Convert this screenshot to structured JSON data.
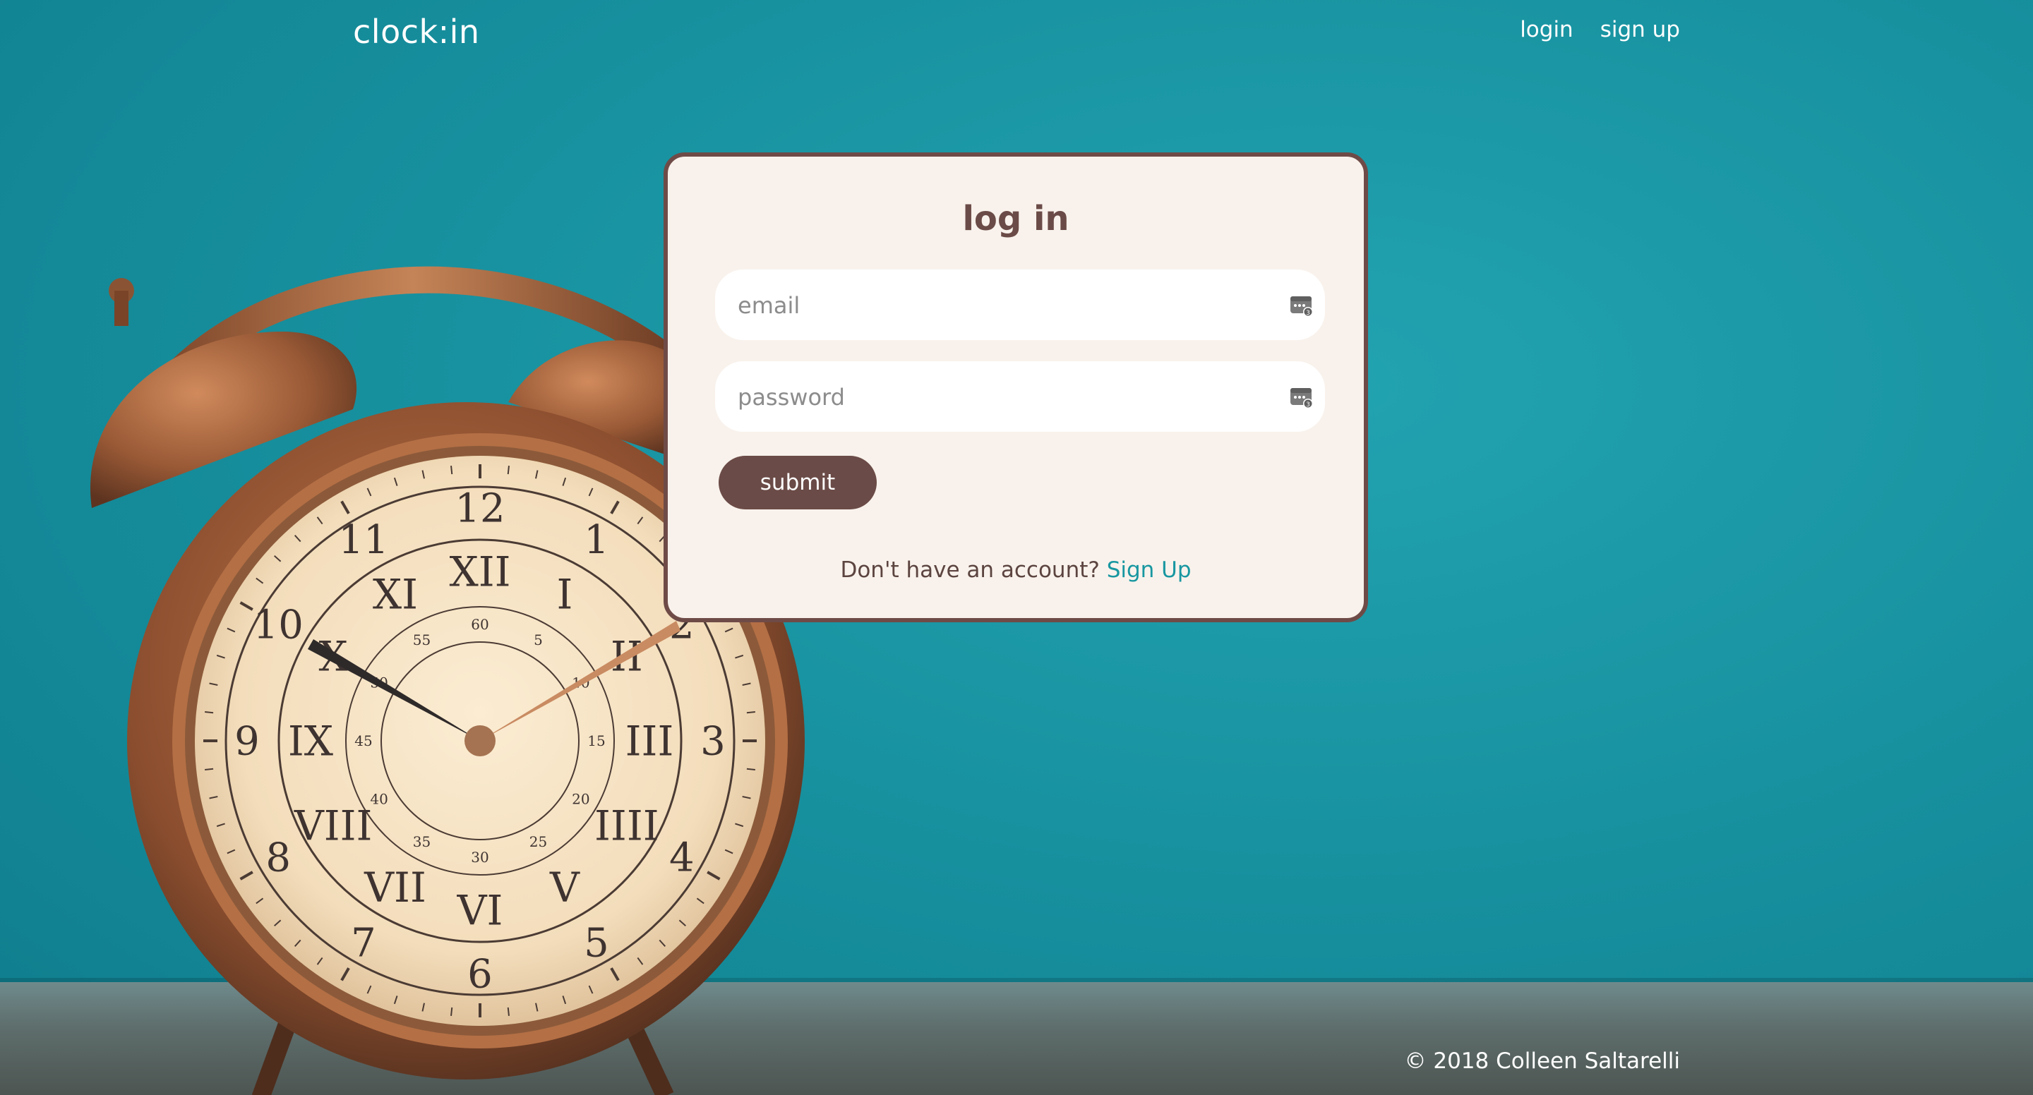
{
  "header": {
    "logo": "clock:in",
    "nav": {
      "login": "login",
      "signup": "sign up"
    }
  },
  "login_card": {
    "title": "log in",
    "email_placeholder": "email",
    "email_value": "",
    "password_placeholder": "password",
    "password_value": "",
    "submit_label": "submit",
    "signup_prompt": "Don't have an account?",
    "signup_link": "Sign Up"
  },
  "background": {
    "clock_numerals": [
      "12",
      "1",
      "2",
      "3",
      "4",
      "5",
      "6",
      "7",
      "8",
      "9",
      "10",
      "11"
    ],
    "roman_numerals": [
      "XII",
      "I",
      "II",
      "III",
      "IIII",
      "V",
      "VI",
      "VII",
      "VIII",
      "IX",
      "X",
      "XI"
    ],
    "minute_marks": [
      "60",
      "5",
      "10",
      "15",
      "20",
      "25",
      "30",
      "35",
      "40",
      "45",
      "50",
      "55"
    ]
  },
  "footer": {
    "copyright": "© 2018 Colleen Saltarelli"
  },
  "colors": {
    "background_teal": "#1892a0",
    "card_background": "#f9f2ec",
    "card_border": "#6f4b47",
    "submit_button": "#6b4b47",
    "link": "#1897a1"
  },
  "icons": {
    "password_manager": "key-icon"
  }
}
